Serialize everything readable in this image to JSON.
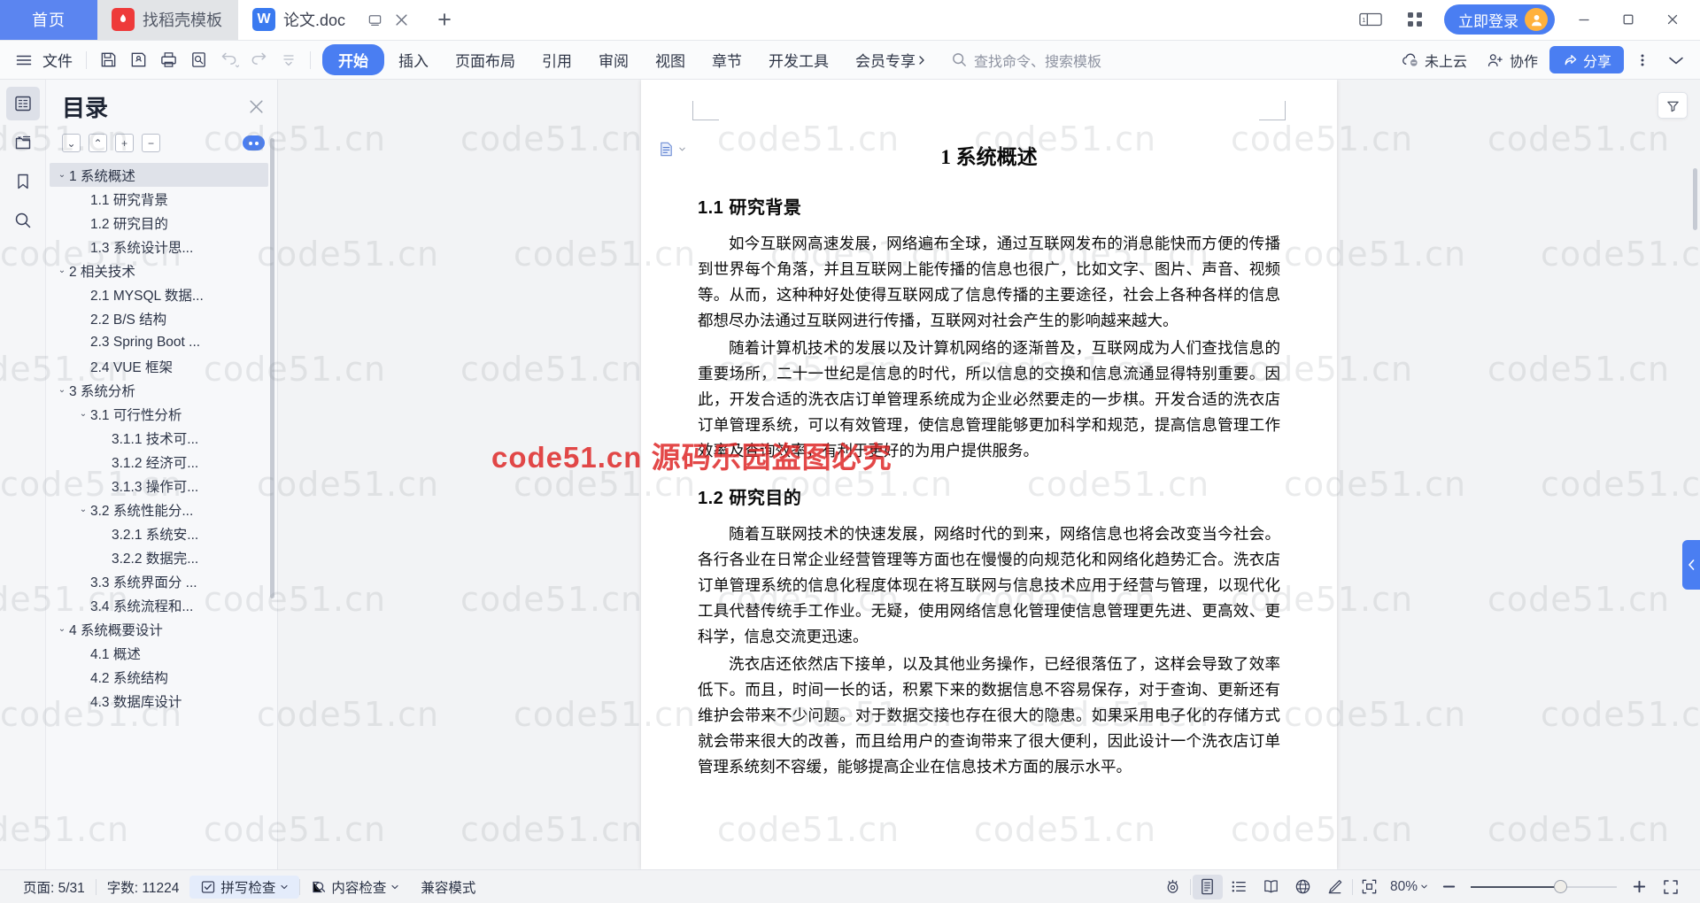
{
  "tabbar": {
    "home_label": "首页",
    "tabs": [
      {
        "label": "找稻壳模板",
        "icon": "wps-template-icon",
        "active": false
      },
      {
        "label": "论文.doc",
        "icon": "wps-writer-icon",
        "active": true
      }
    ],
    "new_tab_label": "+",
    "login_label": "立即登录",
    "icons": [
      "restore-tab-icon",
      "close-tab-icon",
      "window-layout-icon",
      "apps-grid-icon",
      "minimize-icon",
      "maximize-icon",
      "close-window-icon"
    ]
  },
  "ribbon": {
    "menu_label": "文件",
    "quick_icons": [
      "save-icon",
      "save-as-icon",
      "print-icon",
      "print-preview-icon",
      "undo-icon",
      "redo-icon",
      "customize-icon"
    ],
    "tabs": [
      {
        "label": "开始",
        "active": true
      },
      {
        "label": "插入",
        "active": false
      },
      {
        "label": "页面布局",
        "active": false
      },
      {
        "label": "引用",
        "active": false
      },
      {
        "label": "审阅",
        "active": false
      },
      {
        "label": "视图",
        "active": false
      },
      {
        "label": "章节",
        "active": false
      },
      {
        "label": "开发工具",
        "active": false
      },
      {
        "label": "会员专享",
        "active": false
      }
    ],
    "search_placeholder": "查找命令、搜索模板",
    "cloud_label": "未上云",
    "collab_label": "协作",
    "share_label": "分享"
  },
  "rail": {
    "items": [
      {
        "name": "outline-icon",
        "active": true
      },
      {
        "name": "chapter-navigation-icon",
        "active": false
      },
      {
        "name": "bookmark-icon",
        "active": false
      },
      {
        "name": "search-icon",
        "active": false
      }
    ]
  },
  "toc": {
    "title": "目录",
    "tools": [
      {
        "name": "expand-down-button",
        "glyph": "⌄"
      },
      {
        "name": "collapse-up-button",
        "glyph": "⌃"
      },
      {
        "name": "expand-all-button",
        "glyph": "+"
      },
      {
        "name": "collapse-all-button",
        "glyph": "−"
      }
    ],
    "items": [
      {
        "label": "1 系统概述",
        "level": 1,
        "caret": "⌄",
        "selected": true
      },
      {
        "label": "1.1  研究背景",
        "level": 2,
        "caret": "",
        "selected": false
      },
      {
        "label": "1.2 研究目的",
        "level": 2,
        "caret": "",
        "selected": false
      },
      {
        "label": "1.3 系统设计思...",
        "level": 2,
        "caret": "",
        "selected": false
      },
      {
        "label": "2 相关技术",
        "level": 1,
        "caret": "⌄",
        "selected": false
      },
      {
        "label": "2.1 MYSQL 数据...",
        "level": 2,
        "caret": "",
        "selected": false
      },
      {
        "label": "2.2 B/S 结构",
        "level": 2,
        "caret": "",
        "selected": false
      },
      {
        "label": "2.3 Spring Boot ...",
        "level": 2,
        "caret": "",
        "selected": false
      },
      {
        "label": "2.4 VUE 框架",
        "level": 2,
        "caret": "",
        "selected": false
      },
      {
        "label": "3 系统分析",
        "level": 1,
        "caret": "⌄",
        "selected": false
      },
      {
        "label": "3.1 可行性分析",
        "level": 2,
        "caret": "⌄",
        "selected": false
      },
      {
        "label": "3.1.1 技术可...",
        "level": 3,
        "caret": "",
        "selected": false
      },
      {
        "label": "3.1.2 经济可...",
        "level": 3,
        "caret": "",
        "selected": false
      },
      {
        "label": "3.1.3 操作可...",
        "level": 3,
        "caret": "",
        "selected": false
      },
      {
        "label": "3.2 系统性能分...",
        "level": 2,
        "caret": "⌄",
        "selected": false
      },
      {
        "label": "3.2.1  系统安...",
        "level": 3,
        "caret": "",
        "selected": false
      },
      {
        "label": "3.2.2  数据完...",
        "level": 3,
        "caret": "",
        "selected": false
      },
      {
        "label": "3.3 系统界面分 ...",
        "level": 2,
        "caret": "",
        "selected": false
      },
      {
        "label": "3.4 系统流程和...",
        "level": 2,
        "caret": "",
        "selected": false
      },
      {
        "label": "4 系统概要设计",
        "level": 1,
        "caret": "⌄",
        "selected": false
      },
      {
        "label": "4.1 概述",
        "level": 2,
        "caret": "",
        "selected": false
      },
      {
        "label": "4.2 系统结构",
        "level": 2,
        "caret": "",
        "selected": false
      },
      {
        "label": "4.3 数据库设计",
        "level": 2,
        "caret": "",
        "selected": false
      }
    ]
  },
  "document": {
    "title": "1 系统概述",
    "h_background": "1.1  研究背景",
    "p1": "如今互联网高速发展，网络遍布全球，通过互联网发布的消息能快而方便的传播到世界每个角落，并且互联网上能传播的信息也很广，比如文字、图片、声音、视频等。从而，这种种好处使得互联网成了信息传播的主要途径，社会上各种各样的信息都想尽办法通过互联网进行传播，互联网对社会产生的影响越来越大。",
    "p2": "随着计算机技术的发展以及计算机网络的逐渐普及，互联网成为人们查找信息的重要场所，二十一世纪是信息的时代，所以信息的交换和信息流通显得特别重要。因此，开发合适的洗衣店订单管理系统成为企业必然要走的一步棋。开发合适的洗衣店订单管理系统，可以有效管理，使信息管理能够更加科学和规范，提高信息管理工作效率及查询效率，有利于更好的为用户提供服务。",
    "h_purpose": "1.2 研究目的",
    "p3": "随着互联网技术的快速发展，网络时代的到来，网络信息也将会改变当今社会。各行各业在日常企业经营管理等方面也在慢慢的向规范化和网络化趋势汇合。洗衣店订单管理系统的信息化程度体现在将互联网与信息技术应用于经营与管理，以现代化工具代替传统手工作业。无疑，使用网络信息化管理使信息管理更先进、更高效、更科学，信息交流更迅速。",
    "p4": "洗衣店还依然店下接单，以及其他业务操作，已经很落伍了，这样会导致了效率低下。而且，时间一长的话，积累下来的数据信息不容易保存，对于查询、更新还有维护会带来不少问题。对于数据交接也存在很大的隐患。如果采用电子化的存储方式就会带来很大的改善，而且给用户的查询带来了很大便利，因此设计一个洗衣店订单管理系统刻不容缓，能够提高企业在信息技术方面的展示水平。"
  },
  "watermarks": {
    "tile_text": "code51.cn",
    "banner_text": "code51.cn 源码乐园盗图必究",
    "banner_color": "#de2828"
  },
  "status": {
    "page_label": "页面: 5/31",
    "word_count_label": "字数: 11224",
    "spellcheck_label": "拼写检查",
    "contentcheck_label": "内容检查",
    "compat_label": "兼容模式",
    "zoom_label": "80%",
    "view_icons": [
      "reading-eye-icon",
      "print-layout-icon",
      "outline-view-icon",
      "reading-layout-icon",
      "web-layout-icon",
      "edit-pen-icon",
      "fit-page-icon",
      "zoom-out-icon",
      "zoom-in-icon",
      "fullscreen-icon"
    ]
  }
}
